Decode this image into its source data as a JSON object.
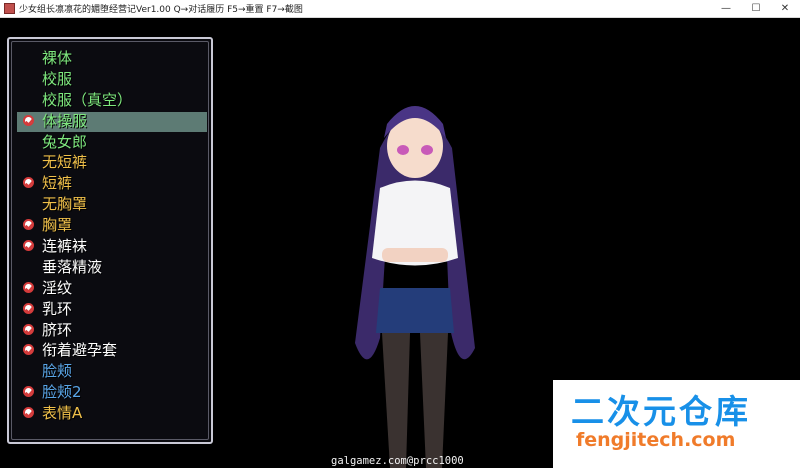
{
  "window": {
    "title": "少女组长凛凛花的媚堕经营记Ver1.00 Q→对话履历 F5→重置 F7→截图",
    "minimize": "—",
    "maximize": "☐",
    "close": "✕"
  },
  "menu": {
    "items": [
      {
        "label": "裸体",
        "checked": false,
        "selected": false,
        "color": "#7ee87e"
      },
      {
        "label": "校服",
        "checked": false,
        "selected": false,
        "color": "#7ee87e"
      },
      {
        "label": "校服（真空）",
        "checked": false,
        "selected": false,
        "color": "#7ee87e"
      },
      {
        "label": "体操服",
        "checked": true,
        "selected": true,
        "color": "#7ee87e"
      },
      {
        "label": "兔女郎",
        "checked": false,
        "selected": false,
        "color": "#7ee87e"
      },
      {
        "label": "无短裤",
        "checked": false,
        "selected": false,
        "color": "#f0c04a"
      },
      {
        "label": "短裤",
        "checked": true,
        "selected": false,
        "color": "#f0c04a"
      },
      {
        "label": "无胸罩",
        "checked": false,
        "selected": false,
        "color": "#f0c04a"
      },
      {
        "label": "胸罩",
        "checked": true,
        "selected": false,
        "color": "#f0c04a"
      },
      {
        "label": "连裤袜",
        "checked": true,
        "selected": false,
        "color": "#ffffff"
      },
      {
        "label": "垂落精液",
        "checked": false,
        "selected": false,
        "color": "#ffffff"
      },
      {
        "label": "淫纹",
        "checked": true,
        "selected": false,
        "color": "#ffffff"
      },
      {
        "label": "乳环",
        "checked": true,
        "selected": false,
        "color": "#ffffff"
      },
      {
        "label": "脐环",
        "checked": true,
        "selected": false,
        "color": "#ffffff"
      },
      {
        "label": "衔着避孕套",
        "checked": true,
        "selected": false,
        "color": "#ffffff"
      },
      {
        "label": "脸颊",
        "checked": false,
        "selected": false,
        "color": "#5aa6e8"
      },
      {
        "label": "脸颊2",
        "checked": true,
        "selected": false,
        "color": "#5aa6e8"
      },
      {
        "label": "表情A",
        "checked": true,
        "selected": false,
        "color": "#f0c04a"
      }
    ]
  },
  "overlay": {
    "url_text": "galgamez.com@prcc1000",
    "brand_name": "二次元仓库",
    "brand_url": "fengjitech.com"
  }
}
